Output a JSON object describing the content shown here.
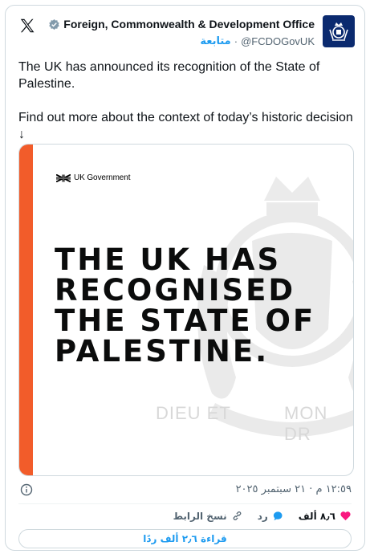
{
  "header": {
    "display_name": "Foreign, Commonwealth & Development Office",
    "handle": "@FCDOGovUK",
    "separator": "·",
    "follow_label": "متابعة"
  },
  "tweet": {
    "line1": "The UK has announced its recognition of the State of Palestine.",
    "line2": "Find out more about the context of today’s historic decision ↓"
  },
  "media": {
    "brand": "UK Government",
    "headline": [
      "THE UK HAS",
      "RECOGNISED",
      "THE STATE OF",
      "PALESTINE."
    ],
    "motto_left": "DIEU ET",
    "motto_right": "MON DR",
    "stripe_color": "#f25c2a"
  },
  "timestamp": "١٢:٥٩ م · ٢١ سبتمبر ٢٠٢٥",
  "actions": {
    "likes": "٨٫٦ ألف",
    "reply_label": "رد",
    "copy_link_label": "نسخ الرابط"
  },
  "read_replies_label": "قراءة ٢٫٦ ألف ردًا",
  "colors": {
    "accent": "#1d9bf0",
    "like": "#f91880"
  },
  "icons": [
    "x-logo-icon",
    "verified-badge-icon",
    "crest-icon",
    "info-icon",
    "heart-icon",
    "reply-icon",
    "link-icon",
    "union-flag-icon"
  ]
}
